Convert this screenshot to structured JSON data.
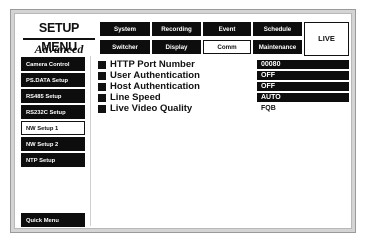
{
  "title": {
    "line1": "SETUP MENU",
    "line2": "Advanced"
  },
  "tabs_top": [
    "System",
    "Recording",
    "Event",
    "Schedule"
  ],
  "tabs_bottom": [
    "Switcher",
    "Display",
    "Comm",
    "Maintenance"
  ],
  "active_tab": "Comm",
  "live_label": "LIVE",
  "sidebar": {
    "items": [
      "Camera Control",
      "PS.DATA Setup",
      "RS485 Setup",
      "RS232C Setup",
      "NW Setup 1",
      "NW Setup 2",
      "NTP Setup"
    ],
    "active": "NW Setup 1",
    "quick_menu": "Quick Menu"
  },
  "settings": [
    {
      "label": "HTTP Port Number",
      "value": "00080"
    },
    {
      "label": "User Authentication",
      "value": "OFF"
    },
    {
      "label": "Host Authentication",
      "value": "OFF"
    },
    {
      "label": "Line Speed",
      "value": "AUTO"
    },
    {
      "label": "Live Video Quality",
      "value": "FQB"
    }
  ],
  "colors": {
    "background": "#ffffff",
    "button": "#0d0d0d",
    "text": "#111111"
  }
}
